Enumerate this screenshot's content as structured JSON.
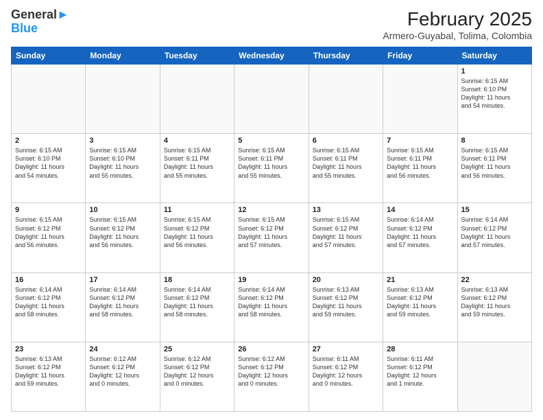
{
  "header": {
    "logo_line1": "General",
    "logo_line2": "Blue",
    "title": "February 2025",
    "subtitle": "Armero-Guyabal, Tolima, Colombia"
  },
  "days": [
    "Sunday",
    "Monday",
    "Tuesday",
    "Wednesday",
    "Thursday",
    "Friday",
    "Saturday"
  ],
  "weeks": [
    [
      {
        "day": "",
        "info": ""
      },
      {
        "day": "",
        "info": ""
      },
      {
        "day": "",
        "info": ""
      },
      {
        "day": "",
        "info": ""
      },
      {
        "day": "",
        "info": ""
      },
      {
        "day": "",
        "info": ""
      },
      {
        "day": "1",
        "info": "Sunrise: 6:15 AM\nSunset: 6:10 PM\nDaylight: 11 hours\nand 54 minutes."
      }
    ],
    [
      {
        "day": "2",
        "info": "Sunrise: 6:15 AM\nSunset: 6:10 PM\nDaylight: 11 hours\nand 54 minutes."
      },
      {
        "day": "3",
        "info": "Sunrise: 6:15 AM\nSunset: 6:10 PM\nDaylight: 11 hours\nand 55 minutes."
      },
      {
        "day": "4",
        "info": "Sunrise: 6:15 AM\nSunset: 6:11 PM\nDaylight: 11 hours\nand 55 minutes."
      },
      {
        "day": "5",
        "info": "Sunrise: 6:15 AM\nSunset: 6:11 PM\nDaylight: 11 hours\nand 55 minutes."
      },
      {
        "day": "6",
        "info": "Sunrise: 6:15 AM\nSunset: 6:11 PM\nDaylight: 11 hours\nand 55 minutes."
      },
      {
        "day": "7",
        "info": "Sunrise: 6:15 AM\nSunset: 6:11 PM\nDaylight: 11 hours\nand 56 minutes."
      },
      {
        "day": "8",
        "info": "Sunrise: 6:15 AM\nSunset: 6:11 PM\nDaylight: 11 hours\nand 56 minutes."
      }
    ],
    [
      {
        "day": "9",
        "info": "Sunrise: 6:15 AM\nSunset: 6:12 PM\nDaylight: 11 hours\nand 56 minutes."
      },
      {
        "day": "10",
        "info": "Sunrise: 6:15 AM\nSunset: 6:12 PM\nDaylight: 11 hours\nand 56 minutes."
      },
      {
        "day": "11",
        "info": "Sunrise: 6:15 AM\nSunset: 6:12 PM\nDaylight: 11 hours\nand 56 minutes."
      },
      {
        "day": "12",
        "info": "Sunrise: 6:15 AM\nSunset: 6:12 PM\nDaylight: 11 hours\nand 57 minutes."
      },
      {
        "day": "13",
        "info": "Sunrise: 6:15 AM\nSunset: 6:12 PM\nDaylight: 11 hours\nand 57 minutes."
      },
      {
        "day": "14",
        "info": "Sunrise: 6:14 AM\nSunset: 6:12 PM\nDaylight: 11 hours\nand 57 minutes."
      },
      {
        "day": "15",
        "info": "Sunrise: 6:14 AM\nSunset: 6:12 PM\nDaylight: 11 hours\nand 57 minutes."
      }
    ],
    [
      {
        "day": "16",
        "info": "Sunrise: 6:14 AM\nSunset: 6:12 PM\nDaylight: 11 hours\nand 58 minutes."
      },
      {
        "day": "17",
        "info": "Sunrise: 6:14 AM\nSunset: 6:12 PM\nDaylight: 11 hours\nand 58 minutes."
      },
      {
        "day": "18",
        "info": "Sunrise: 6:14 AM\nSunset: 6:12 PM\nDaylight: 11 hours\nand 58 minutes."
      },
      {
        "day": "19",
        "info": "Sunrise: 6:14 AM\nSunset: 6:12 PM\nDaylight: 11 hours\nand 58 minutes."
      },
      {
        "day": "20",
        "info": "Sunrise: 6:13 AM\nSunset: 6:12 PM\nDaylight: 11 hours\nand 59 minutes."
      },
      {
        "day": "21",
        "info": "Sunrise: 6:13 AM\nSunset: 6:12 PM\nDaylight: 11 hours\nand 59 minutes."
      },
      {
        "day": "22",
        "info": "Sunrise: 6:13 AM\nSunset: 6:12 PM\nDaylight: 11 hours\nand 59 minutes."
      }
    ],
    [
      {
        "day": "23",
        "info": "Sunrise: 6:13 AM\nSunset: 6:12 PM\nDaylight: 11 hours\nand 59 minutes."
      },
      {
        "day": "24",
        "info": "Sunrise: 6:12 AM\nSunset: 6:12 PM\nDaylight: 12 hours\nand 0 minutes."
      },
      {
        "day": "25",
        "info": "Sunrise: 6:12 AM\nSunset: 6:12 PM\nDaylight: 12 hours\nand 0 minutes."
      },
      {
        "day": "26",
        "info": "Sunrise: 6:12 AM\nSunset: 6:12 PM\nDaylight: 12 hours\nand 0 minutes."
      },
      {
        "day": "27",
        "info": "Sunrise: 6:11 AM\nSunset: 6:12 PM\nDaylight: 12 hours\nand 0 minutes."
      },
      {
        "day": "28",
        "info": "Sunrise: 6:11 AM\nSunset: 6:12 PM\nDaylight: 12 hours\nand 1 minute."
      },
      {
        "day": "",
        "info": ""
      }
    ]
  ]
}
